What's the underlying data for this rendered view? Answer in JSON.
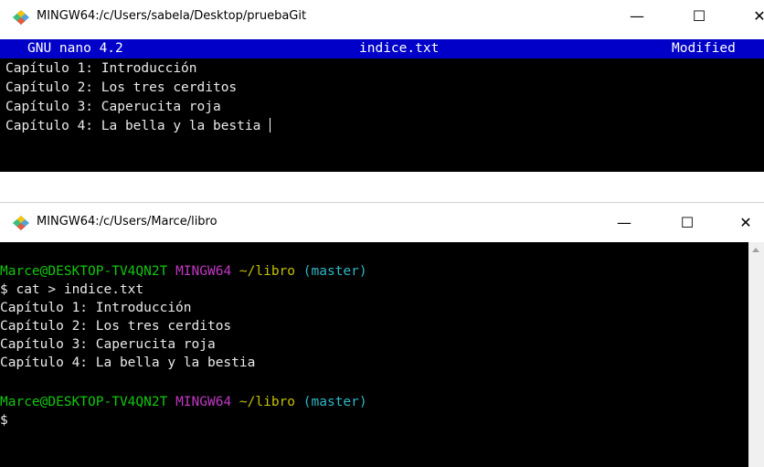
{
  "window1": {
    "title": "MINGW64:/c/Users/sabela/Desktop/pruebaGit",
    "controls": {
      "minimize": "—",
      "maximize": "☐",
      "close": "✕"
    },
    "nano": {
      "version": "GNU nano 4.2",
      "filename": "indice.txt",
      "status": "Modified"
    },
    "lines": [
      "Capítulo 1: Introducción",
      "Capítulo 2: Los tres cerditos",
      "Capítulo 3: Caperucita roja",
      "Capítulo 4: La bella y la bestia "
    ]
  },
  "window2": {
    "title": "MINGW64:/c/Users/Marce/libro",
    "controls": {
      "minimize": "—",
      "maximize": "☐",
      "close": "✕"
    },
    "prompt1": {
      "user_host": "Marce@DESKTOP-TV4QN2T",
      "shell": "MINGW64",
      "path": "~/libro",
      "branch": "(master)"
    },
    "command": "$ cat > indice.txt",
    "output": [
      "Capítulo 1: Introducción",
      "Capítulo 2: Los tres cerditos",
      "Capítulo 3: Caperucita roja",
      "Capítulo 4: La bella y la bestia"
    ],
    "prompt2": {
      "user_host": "Marce@DESKTOP-TV4QN2T",
      "shell": "MINGW64",
      "path": "~/libro",
      "branch": "(master)"
    },
    "cursor_prompt": "$"
  },
  "colors": {
    "terminal_bg": "#000000",
    "nano_bar": "#0000c8",
    "prompt_green": "#13c50f",
    "prompt_magenta": "#c238c4",
    "prompt_yellow": "#c4c000",
    "prompt_cyan": "#2fb7c6"
  },
  "icons": [
    "git-bash-app-icon",
    "minimize-icon",
    "maximize-icon",
    "close-icon",
    "scroll-up-arrow-icon"
  ]
}
